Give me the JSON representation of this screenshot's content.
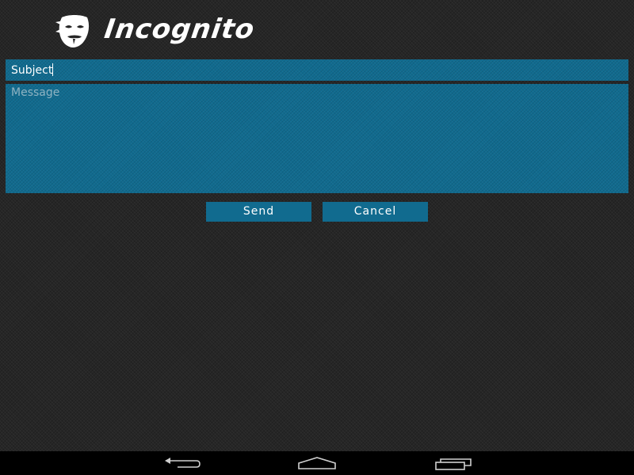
{
  "app": {
    "title": "Incognito",
    "logo_icon": "anonymous-mask-icon"
  },
  "form": {
    "subject": {
      "value": "Subject"
    },
    "message": {
      "placeholder": "Message",
      "value": ""
    }
  },
  "buttons": {
    "send_label": "Send",
    "cancel_label": "Cancel"
  },
  "navbar": {
    "back_icon": "back-arrow-icon",
    "home_icon": "home-icon",
    "recent_icon": "recent-apps-icon"
  },
  "colors": {
    "background": "#262626",
    "field": "#116b8f",
    "text": "#ffffff",
    "placeholder": "#8fb3c2",
    "navbar": "#000000"
  }
}
